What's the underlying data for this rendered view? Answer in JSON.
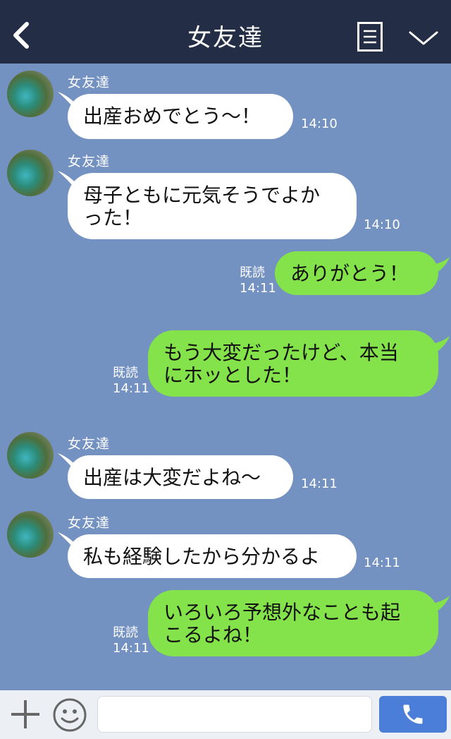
{
  "header": {
    "title": "女友達",
    "back_icon": "chevron-left-icon",
    "menu_icon": "list-icon",
    "dropdown_icon": "chevron-down-icon"
  },
  "colors": {
    "header_bg": "#232d45",
    "chat_bg": "#7391c1",
    "outgoing_bubble": "#84e24a",
    "incoming_bubble": "#ffffff",
    "send_button": "#4a7ed8"
  },
  "messages": [
    {
      "direction": "in",
      "sender": "女友達",
      "lines": [
        "出産おめでとう〜！"
      ],
      "time": "14:10"
    },
    {
      "direction": "in",
      "sender": "女友達",
      "lines": [
        "母子ともに元気そうでよか",
        "った！"
      ],
      "time": "14:10"
    },
    {
      "direction": "out",
      "read": "既読",
      "lines": [
        "ありがとう！"
      ],
      "time": "14:11"
    },
    {
      "direction": "out",
      "read": "既読",
      "lines": [
        "もう大変だったけど、本当",
        "にホッとした！"
      ],
      "time": "14:11"
    },
    {
      "direction": "in",
      "sender": "女友達",
      "lines": [
        "出産は大変だよね〜"
      ],
      "time": "14:11"
    },
    {
      "direction": "in",
      "sender": "女友達",
      "lines": [
        "私も経験したから分かるよ"
      ],
      "time": "14:11"
    },
    {
      "direction": "out",
      "read": "既読",
      "lines": [
        "いろいろ予想外なことも起",
        "こるよね！"
      ],
      "time": "14:11"
    }
  ],
  "footer": {
    "plus_icon": "plus-icon",
    "emoji_icon": "smiley-icon",
    "input_value": "",
    "call_icon": "phone-icon"
  }
}
